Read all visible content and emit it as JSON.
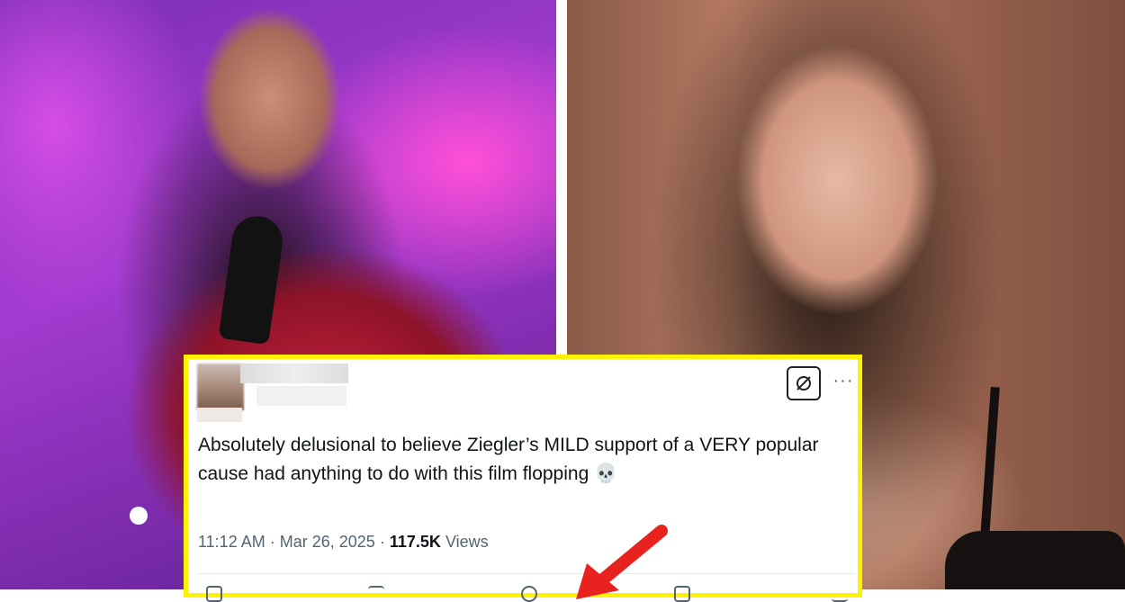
{
  "tweet": {
    "text": "Absolutely delusional to believe Ziegler’s MILD support of a VERY popular cause had anything to do with this film flopping 💀",
    "time": "11:12 AM",
    "separator": "·",
    "date": "Mar 26, 2025",
    "views_count": "117.5K",
    "views_label": "Views",
    "more_label": "···"
  },
  "colors": {
    "highlight_border": "#fff200",
    "arrow": "#e8231f",
    "text": "#0f1419",
    "muted": "#536471"
  }
}
